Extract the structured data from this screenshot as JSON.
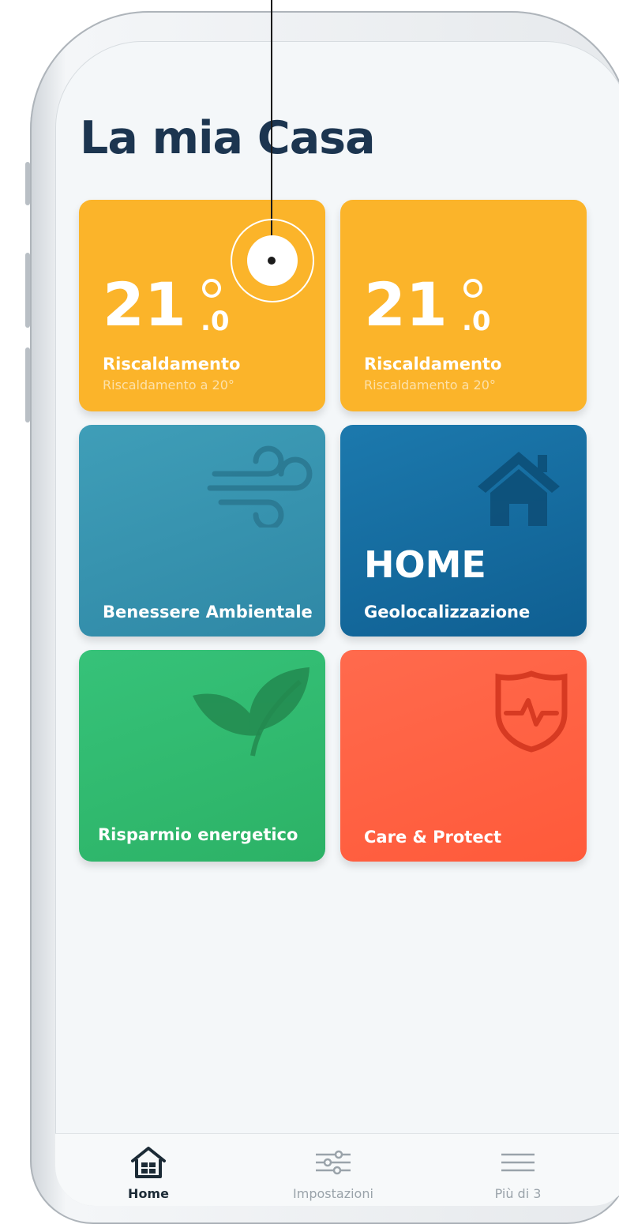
{
  "page": {
    "title": "La mia Casa"
  },
  "tiles": [
    {
      "title": "Riscaldamento",
      "subtitle": "Riscaldamento a 20°",
      "temp_int": "21",
      "temp_dec": ".0",
      "color": "#fbb42a"
    },
    {
      "title": "Riscaldamento",
      "subtitle": "Riscaldamento a 20°",
      "temp_int": "21",
      "temp_dec": ".0",
      "color": "#fbb42a"
    },
    {
      "title": "Benessere Ambientale",
      "icon": "wind-icon",
      "color": "#3796b1"
    },
    {
      "title": "Geolocalizzazione",
      "status": "HOME",
      "icon": "house-icon",
      "color": "#156aa0"
    },
    {
      "title": "Risparmio energetico",
      "icon": "leaf-icon",
      "color": "#32b96f"
    },
    {
      "title": "Care & Protect",
      "icon": "shield-heartbeat-icon",
      "color": "#ff6246"
    }
  ],
  "tabbar": {
    "items": [
      {
        "label": "Home",
        "icon": "home-icon",
        "active": true
      },
      {
        "label": "Impostazioni",
        "icon": "sliders-icon",
        "active": false
      },
      {
        "label": "Più di 3",
        "icon": "menu-icon",
        "active": false
      }
    ]
  }
}
